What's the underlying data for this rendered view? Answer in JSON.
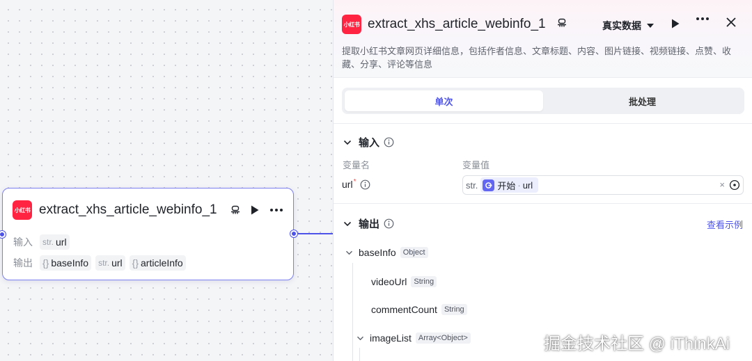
{
  "node": {
    "logo_text": "小红书",
    "title": "extract_xhs_article_webinfo_1",
    "ellipsis": "…",
    "input_label": "输入",
    "output_label": "输出",
    "inputs": [
      {
        "type": "str.",
        "name": "url"
      }
    ],
    "outputs": [
      {
        "type": "{}",
        "name": "baseInfo"
      },
      {
        "type": "str.",
        "name": "url"
      },
      {
        "type": "{}",
        "name": "articleInfo"
      }
    ]
  },
  "panel": {
    "logo_text": "小红书",
    "title": "extract_xhs_article_webinfo_1",
    "mode_label": "真实数据",
    "more_label": "···",
    "description": "提取小红书文章网页详细信息，包括作者信息、文章标题、内容、图片链接、视频链接、点赞、收藏、分享、评论等信息",
    "tabs": [
      {
        "label": "单次"
      },
      {
        "label": "批处理"
      }
    ],
    "input_section": {
      "title": "输入",
      "col_name": "变量名",
      "col_value": "变量值",
      "var_name": "url",
      "required_mark": "*",
      "value_type": "str.",
      "ref_source": "开始",
      "ref_separator": "·",
      "ref_var": "url",
      "clear_label": "×"
    },
    "output_section": {
      "title": "输出",
      "example_link": "查看示例",
      "tree": [
        {
          "name": "baseInfo",
          "type": "Object"
        },
        {
          "name": "videoUrl",
          "type": "String"
        },
        {
          "name": "commentCount",
          "type": "String"
        },
        {
          "name": "imageList",
          "type": "Array<Object>"
        }
      ]
    }
  },
  "watermark": "掘金技术社区 @ iThinkAi",
  "colors": {
    "accent": "#4d53e8",
    "brand_red": "#ff2442",
    "required": "#f54a45"
  }
}
